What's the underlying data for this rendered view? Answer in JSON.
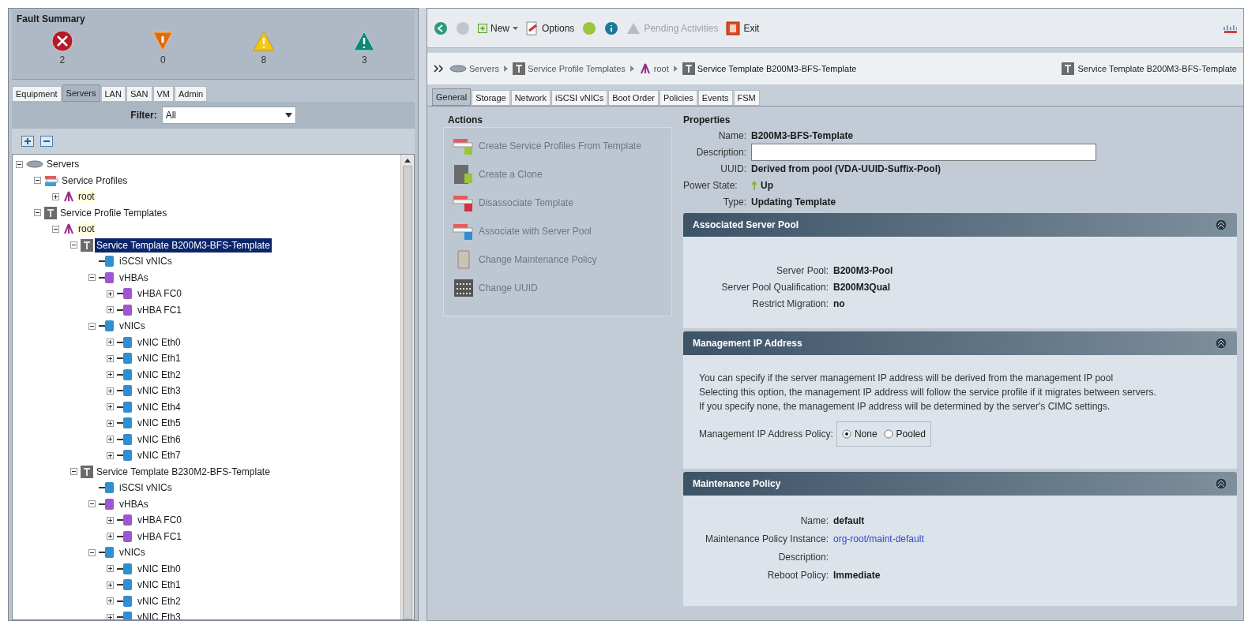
{
  "fault_summary": {
    "title": "Fault Summary",
    "faults": [
      {
        "kind": "critical",
        "count": "2"
      },
      {
        "kind": "major",
        "count": "0"
      },
      {
        "kind": "minor",
        "count": "8"
      },
      {
        "kind": "warning",
        "count": "3"
      }
    ]
  },
  "nav_tabs": [
    {
      "label": "Equipment",
      "selected": false
    },
    {
      "label": "Servers",
      "selected": true
    },
    {
      "label": "LAN",
      "selected": false
    },
    {
      "label": "SAN",
      "selected": false
    },
    {
      "label": "VM",
      "selected": false
    },
    {
      "label": "Admin",
      "selected": false
    }
  ],
  "filter": {
    "label": "Filter:",
    "value": "All"
  },
  "tree": [
    {
      "label": "Servers",
      "kind": "servers",
      "expanded": true,
      "selected": false,
      "children": [
        {
          "label": "Service Profiles",
          "kind": "profiles",
          "expanded": true,
          "selected": false,
          "children": [
            {
              "label": "root",
              "kind": "org",
              "expanded": false,
              "selected": false
            }
          ]
        },
        {
          "label": "Service Profile Templates",
          "kind": "template",
          "expanded": true,
          "selected": false,
          "children": [
            {
              "label": "root",
              "kind": "org",
              "expanded": true,
              "selected": false,
              "children": [
                {
                  "label": "Service Template B200M3-BFS-Template",
                  "kind": "template",
                  "expanded": true,
                  "selected": true,
                  "children": [
                    {
                      "label": "iSCSI vNICs",
                      "kind": "nic",
                      "selected": false
                    },
                    {
                      "label": "vHBAs",
                      "kind": "hba",
                      "expanded": true,
                      "selected": false,
                      "children": [
                        {
                          "label": "vHBA FC0",
                          "kind": "hba",
                          "expanded": false,
                          "selected": false
                        },
                        {
                          "label": "vHBA FC1",
                          "kind": "hba",
                          "expanded": false,
                          "selected": false
                        }
                      ]
                    },
                    {
                      "label": "vNICs",
                      "kind": "nic",
                      "expanded": true,
                      "selected": false,
                      "children": [
                        {
                          "label": "vNIC Eth0",
                          "kind": "nic",
                          "expanded": false,
                          "selected": false
                        },
                        {
                          "label": "vNIC Eth1",
                          "kind": "nic",
                          "expanded": false,
                          "selected": false
                        },
                        {
                          "label": "vNIC Eth2",
                          "kind": "nic",
                          "expanded": false,
                          "selected": false
                        },
                        {
                          "label": "vNIC Eth3",
                          "kind": "nic",
                          "expanded": false,
                          "selected": false
                        },
                        {
                          "label": "vNIC Eth4",
                          "kind": "nic",
                          "expanded": false,
                          "selected": false
                        },
                        {
                          "label": "vNIC Eth5",
                          "kind": "nic",
                          "expanded": false,
                          "selected": false
                        },
                        {
                          "label": "vNIC Eth6",
                          "kind": "nic",
                          "expanded": false,
                          "selected": false
                        },
                        {
                          "label": "vNIC Eth7",
                          "kind": "nic",
                          "expanded": false,
                          "selected": false
                        }
                      ]
                    }
                  ]
                },
                {
                  "label": "Service Template B230M2-BFS-Template",
                  "kind": "template",
                  "expanded": true,
                  "selected": false,
                  "children": [
                    {
                      "label": "iSCSI vNICs",
                      "kind": "nic",
                      "selected": false
                    },
                    {
                      "label": "vHBAs",
                      "kind": "hba",
                      "expanded": true,
                      "selected": false,
                      "children": [
                        {
                          "label": "vHBA FC0",
                          "kind": "hba",
                          "expanded": false,
                          "selected": false
                        },
                        {
                          "label": "vHBA FC1",
                          "kind": "hba",
                          "expanded": false,
                          "selected": false
                        }
                      ]
                    },
                    {
                      "label": "vNICs",
                      "kind": "nic",
                      "expanded": true,
                      "selected": false,
                      "children": [
                        {
                          "label": "vNIC Eth0",
                          "kind": "nic",
                          "expanded": false,
                          "selected": false
                        },
                        {
                          "label": "vNIC Eth1",
                          "kind": "nic",
                          "expanded": false,
                          "selected": false
                        },
                        {
                          "label": "vNIC Eth2",
                          "kind": "nic",
                          "expanded": false,
                          "selected": false
                        },
                        {
                          "label": "vNIC Eth3",
                          "kind": "nic",
                          "expanded": false,
                          "selected": false
                        }
                      ]
                    }
                  ]
                }
              ]
            }
          ]
        }
      ]
    }
  ],
  "toolbar": [
    {
      "kind": "back"
    },
    {
      "kind": "forward"
    },
    {
      "kind": "new",
      "label": "New"
    },
    {
      "kind": "options",
      "label": "Options"
    },
    {
      "kind": "help"
    },
    {
      "kind": "info"
    },
    {
      "kind": "pending",
      "label": "Pending Activities",
      "disabled": true
    },
    {
      "kind": "exit",
      "label": "Exit"
    }
  ],
  "breadcrumb": [
    {
      "label": "Servers",
      "kind": "servers"
    },
    {
      "label": "Service Profile Templates",
      "kind": "template"
    },
    {
      "label": "root",
      "kind": "org"
    },
    {
      "label": "Service Template B200M3-BFS-Template",
      "kind": "template"
    }
  ],
  "current_object": "Service Template B200M3-BFS-Template",
  "content_tabs": [
    {
      "label": "General",
      "selected": true
    },
    {
      "label": "Storage",
      "selected": false
    },
    {
      "label": "Network",
      "selected": false
    },
    {
      "label": "iSCSI vNICs",
      "selected": false
    },
    {
      "label": "Boot Order",
      "selected": false
    },
    {
      "label": "Policies",
      "selected": false
    },
    {
      "label": "Events",
      "selected": false
    },
    {
      "label": "FSM",
      "selected": false
    }
  ],
  "actions": {
    "title": "Actions",
    "items": [
      {
        "label": "Create Service Profiles From Template",
        "kind": "create"
      },
      {
        "label": "Create a Clone",
        "kind": "clone"
      },
      {
        "label": "Disassociate Template",
        "kind": "disassociate"
      },
      {
        "label": "Associate with Server Pool",
        "kind": "associate"
      },
      {
        "label": "Change Maintenance Policy",
        "kind": "maintenance"
      },
      {
        "label": "Change UUID",
        "kind": "uuid"
      }
    ]
  },
  "properties": {
    "title": "Properties",
    "name": {
      "label": "Name:",
      "value": "B200M3-BFS-Template"
    },
    "description": {
      "label": "Description:"
    },
    "uuid": {
      "label": "UUID:",
      "value": "Derived from pool (VDA-UUID-Suffix-Pool)"
    },
    "power_state": {
      "label": "Power State:",
      "value": "Up"
    },
    "type": {
      "label": "Type:",
      "value": "Updating Template"
    }
  },
  "server_pool": {
    "title": "Associated Server Pool",
    "fields": [
      {
        "label": "Server Pool:",
        "value": "B200M3-Pool"
      },
      {
        "label": "Server Pool Qualification:",
        "value": "B200M3Qual"
      },
      {
        "label": "Restrict Migration:",
        "value": "no"
      }
    ]
  },
  "management_ip": {
    "title": "Management IP Address",
    "description": [
      "You can specify if the server management IP address will be derived from the management IP pool",
      "Selecting this option, the management IP address will follow the service profile if it migrates between servers.",
      "If you specify none, the management IP address will be determined by the server's CIMC settings."
    ],
    "policy_label": "Management IP Address Policy:",
    "options": [
      {
        "label": "None",
        "selected": true
      },
      {
        "label": "Pooled",
        "selected": false
      }
    ]
  },
  "maintenance_policy": {
    "title": "Maintenance Policy",
    "fields": [
      {
        "label": "Name:",
        "value": "default",
        "kind": "text"
      },
      {
        "label": "Maintenance Policy Instance:",
        "value": "org-root/maint-default",
        "kind": "link"
      },
      {
        "label": "Description:"
      },
      {
        "label": "Reboot Policy:",
        "value": "Immediate",
        "kind": "text"
      }
    ]
  }
}
